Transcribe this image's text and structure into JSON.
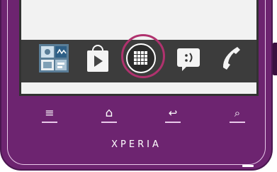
{
  "device": {
    "brand": "XPERIA",
    "body_color": "#6d2470",
    "accent_ring_color": "#b0326e"
  },
  "dock": {
    "icons": [
      {
        "name": "media-folder-icon",
        "label": ""
      },
      {
        "name": "play-store-icon",
        "label": ""
      },
      {
        "name": "apps-grid-icon",
        "label": ""
      },
      {
        "name": "messaging-icon",
        "label": ""
      },
      {
        "name": "phone-icon",
        "label": ""
      }
    ]
  },
  "keys": [
    {
      "name": "menu-key",
      "glyph": "≡"
    },
    {
      "name": "home-key",
      "glyph": "⌂"
    },
    {
      "name": "back-key",
      "glyph": "↩"
    },
    {
      "name": "search-key",
      "glyph": "⌕"
    }
  ]
}
